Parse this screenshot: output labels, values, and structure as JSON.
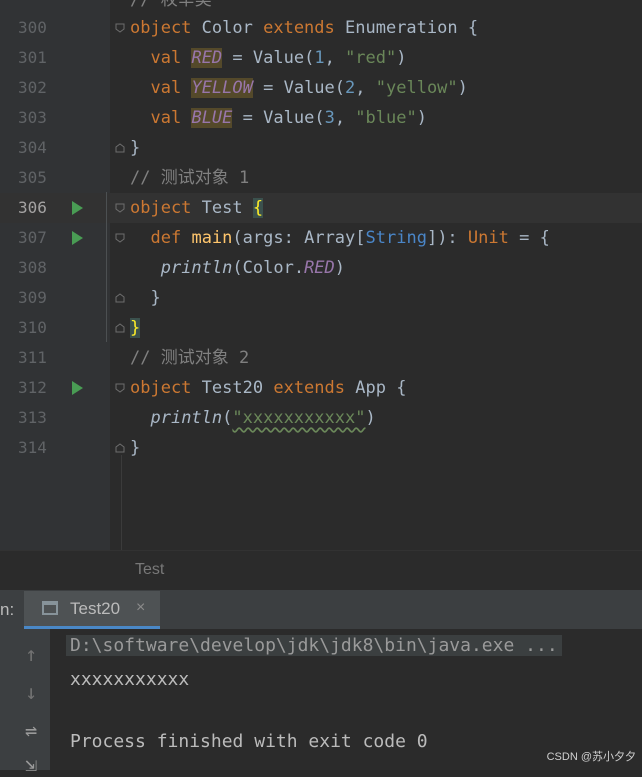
{
  "editor": {
    "top_partial_comment": "// 枚举类",
    "lines": [
      {
        "n": "300"
      },
      {
        "n": "301"
      },
      {
        "n": "302"
      },
      {
        "n": "303"
      },
      {
        "n": "304"
      },
      {
        "n": "305"
      },
      {
        "n": "306"
      },
      {
        "n": "307"
      },
      {
        "n": "308"
      },
      {
        "n": "309"
      },
      {
        "n": "310"
      },
      {
        "n": "311"
      },
      {
        "n": "312"
      },
      {
        "n": "313"
      },
      {
        "n": "314"
      }
    ],
    "tokens": {
      "object": "object",
      "extends": "extends",
      "val": "val",
      "def": "def",
      "Color": "Color",
      "Enumeration": "Enumeration",
      "RED": "RED",
      "YELLOW": "YELLOW",
      "BLUE": "BLUE",
      "Value": "Value",
      "n1": "1",
      "n2": "2",
      "n3": "3",
      "red_str": "\"red\"",
      "yellow_str": "\"yellow\"",
      "blue_str": "\"blue\"",
      "comment1": "// 测试对象 1",
      "comment2": "// 测试对象 2",
      "Test": "Test",
      "main": "main",
      "args": "args",
      "Array": "Array",
      "String": "String",
      "Unit": "Unit",
      "println": "println",
      "Test20": "Test20",
      "App": "App",
      "xstr": "\"xxxxxxxxxxx\""
    },
    "breadcrumb": "Test"
  },
  "run": {
    "label": "n:",
    "tab_title": "Test20",
    "tab_close": "×",
    "output": {
      "command": "D:\\software\\develop\\jdk\\jdk8\\bin\\java.exe ...",
      "printed": "xxxxxxxxxxx",
      "finished": "Process finished with exit code 0"
    }
  },
  "watermark": "CSDN @苏小夕夕",
  "colors": {
    "keyword": "#cc7832",
    "field": "#9876aa",
    "string": "#6a8759",
    "number": "#6897bb",
    "run": "#499c54",
    "accent": "#4a88c7"
  }
}
